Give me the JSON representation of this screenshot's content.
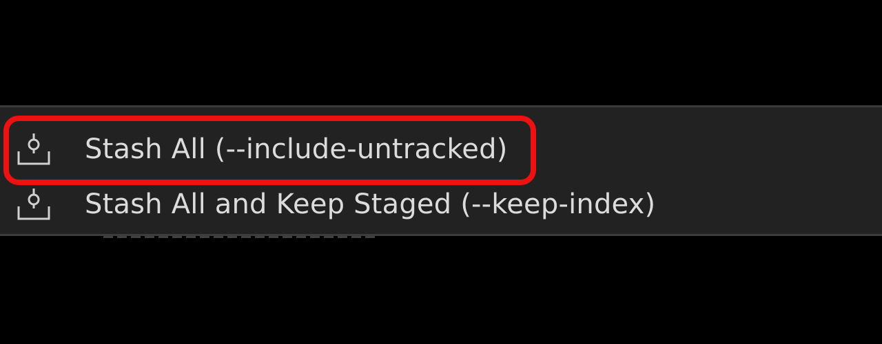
{
  "menu": {
    "items": [
      {
        "label": "Stash All (--include-untracked)",
        "icon": "stash-icon",
        "highlighted": true
      },
      {
        "label": "Stash All and Keep Staged (--keep-index)",
        "icon": "stash-icon",
        "highlighted": false
      }
    ]
  },
  "colors": {
    "background": "#000000",
    "menu_background": "#222222",
    "text": "#dcdcdc",
    "highlight_outline": "#ee1111"
  }
}
